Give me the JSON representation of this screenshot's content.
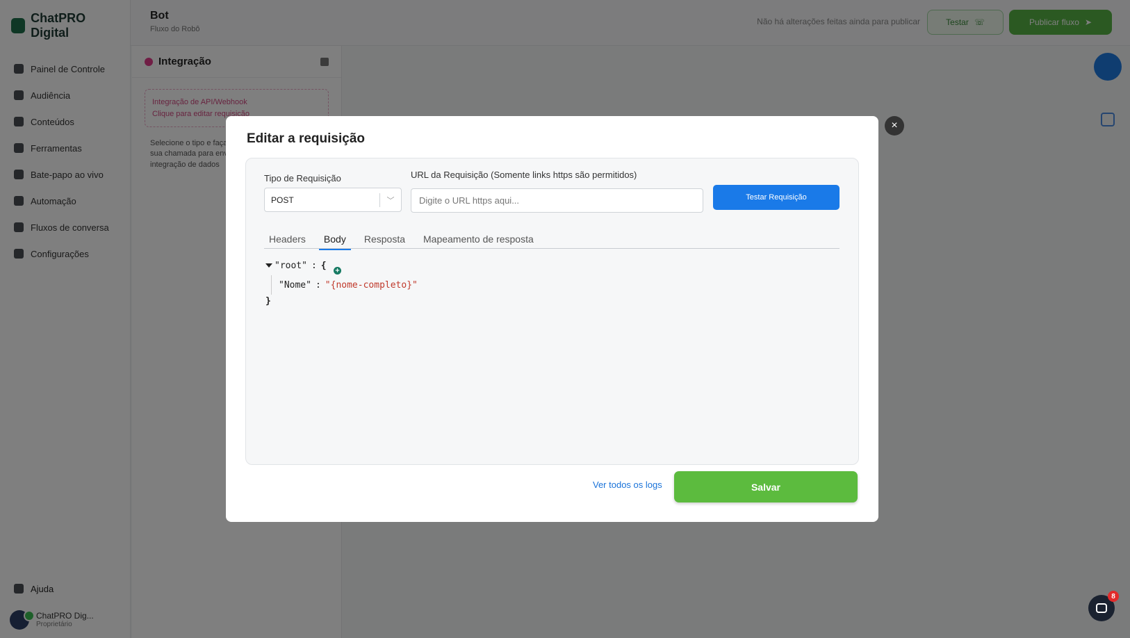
{
  "app": {
    "brand": "ChatPRO Digital",
    "nav": [
      "Painel de Controle",
      "Audiência",
      "Conteúdos",
      "Ferramentas",
      "Bate-papo ao vivo",
      "Automação",
      "Fluxos de conversa",
      "Configurações"
    ],
    "help": "Ajuda",
    "user_name": "ChatPRO Dig...",
    "user_sub": "Proprietário"
  },
  "topbar": {
    "title": "Bot",
    "subtitle": "Fluxo do Robô",
    "hint": "Não há alterações feitas ainda para publicar",
    "test_btn": "Testar",
    "publish_btn": "Publicar fluxo"
  },
  "panel": {
    "title": "Integração",
    "card_line1": "Integração de API/Webhook",
    "card_line2": "Clique para editar requisição",
    "text_line1": "Selecione o tipo e faça",
    "text_line2": "sua chamada para enviar",
    "text_line3": "integração de dados"
  },
  "chat": {
    "badge": "8"
  },
  "modal": {
    "title": "Editar a requisição",
    "close": "×",
    "request_type_label": "Tipo de Requisição",
    "request_type_value": "POST",
    "url_label": "URL da Requisição (Somente links https são permitidos)",
    "url_placeholder": "Digite o URL https aqui...",
    "test_button": "Testar Requisição",
    "tabs": [
      "Headers",
      "Body",
      "Resposta",
      "Mapeamento de resposta"
    ],
    "active_tab": "Body",
    "body": {
      "root_key": "\"root\"",
      "open_brace": "{",
      "close_brace": "}",
      "colon": ":",
      "field_key": "\"Nome\"",
      "field_value": "\"{nome-completo}\""
    },
    "logs_link": "Ver todos os logs",
    "save_button": "Salvar"
  }
}
